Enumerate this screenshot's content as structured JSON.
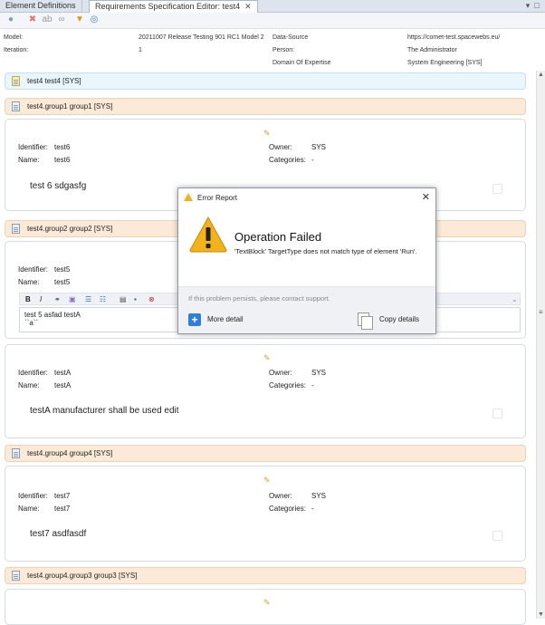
{
  "tabs": [
    {
      "label": "Element Definitions"
    },
    {
      "label": "Requirements Specification Editor: test4"
    }
  ],
  "tab_close_glyph": "✕",
  "window_controls": [
    "▾",
    "□"
  ],
  "toolbar": {
    "icons": [
      "add-icon",
      "delete-icon",
      "spellcheck-icon",
      "binoculars-icon",
      "filter-icon",
      "search-icon"
    ]
  },
  "meta": {
    "model_label": "Model:",
    "model_value": "20211007 Release Testing 901 RC1 Model 2",
    "iteration_label": "Iteration:",
    "iteration_value": "1",
    "datasource_label": "Data-Source",
    "datasource_value": "https://comet-test.spacewebs.eu/",
    "person_label": "Person:",
    "person_value": "The Administrator",
    "domain_label": "Domain Of Expertise",
    "domain_value": "System Engineering [SYS]"
  },
  "spec_header": "test4   test4   [SYS]",
  "groups": [
    "test4.group1  group1  [SYS]",
    "test4.group2  group2  [SYS]",
    "test4.group4  group4  [SYS]",
    "test4.group4.group3  group3  [SYS]"
  ],
  "labels": {
    "identifier": "Identifier:",
    "name": "Name:",
    "owner": "Owner:",
    "categories": "Categories:"
  },
  "requirements": [
    {
      "identifier": "test6",
      "name": "test6",
      "owner": "SYS",
      "categories": "-",
      "text": "test 6 sdgasfg"
    },
    {
      "identifier": "test5",
      "name": "test5",
      "text_line1": "test 5 asfad testA",
      "text_line2": "``a``"
    },
    {
      "identifier": "testA",
      "name": "testA",
      "owner": "SYS",
      "categories": "-",
      "text": "testA manufacturer shall be used edit"
    },
    {
      "identifier": "test7",
      "name": "test7",
      "owner": "SYS",
      "categories": "-",
      "text": "test7 asdfasdf"
    }
  ],
  "editor_buttons": [
    "B",
    "I"
  ],
  "dialog": {
    "title": "Error Report",
    "close_glyph": "✕",
    "heading": "Operation Failed",
    "message": "'TextBlock' TargetType does not match type of element 'Run'.",
    "hint": "If this problem persists, please contact support.",
    "more_detail": "More detail",
    "copy_details": "Copy details",
    "warning_color": "#f2b21b"
  }
}
